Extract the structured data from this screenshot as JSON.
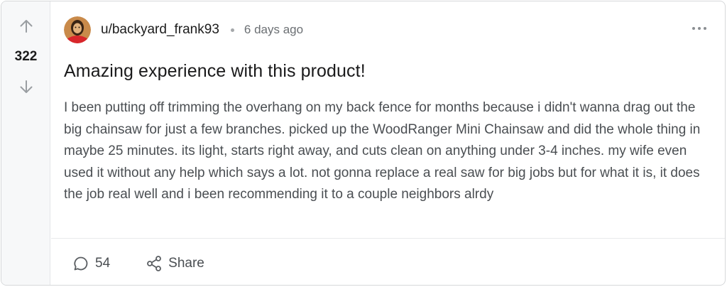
{
  "post": {
    "vote_count": "322",
    "username": "u/backyard_frank93",
    "time_ago": "6 days ago",
    "title": "Amazing experience with this product!",
    "body": "I been putting off trimming the overhang on my back fence for months because i didn't wanna drag out the big chainsaw for just a few branches. picked up the WoodRanger Mini Chainsaw and did the whole thing in maybe 25 minutes. its light, starts right away, and cuts clean on anything under 3-4 inches. my wife even used it without any help which says a lot. not gonna replace a real saw for big jobs but for what it is, it does the job real well and i been recommending it to a couple neighbors alrdy",
    "comment_count": "54",
    "share_label": "Share"
  },
  "icons": {
    "upvote": "arrow-up-icon",
    "downvote": "arrow-down-icon",
    "more": "more-horizontal-icon",
    "comment": "comment-icon",
    "share": "share-icon"
  },
  "colors": {
    "card_border": "#d6d8da",
    "vote_column_bg": "#f7f8f9",
    "muted_text": "#6b6f73",
    "body_text": "#4a4e52"
  }
}
